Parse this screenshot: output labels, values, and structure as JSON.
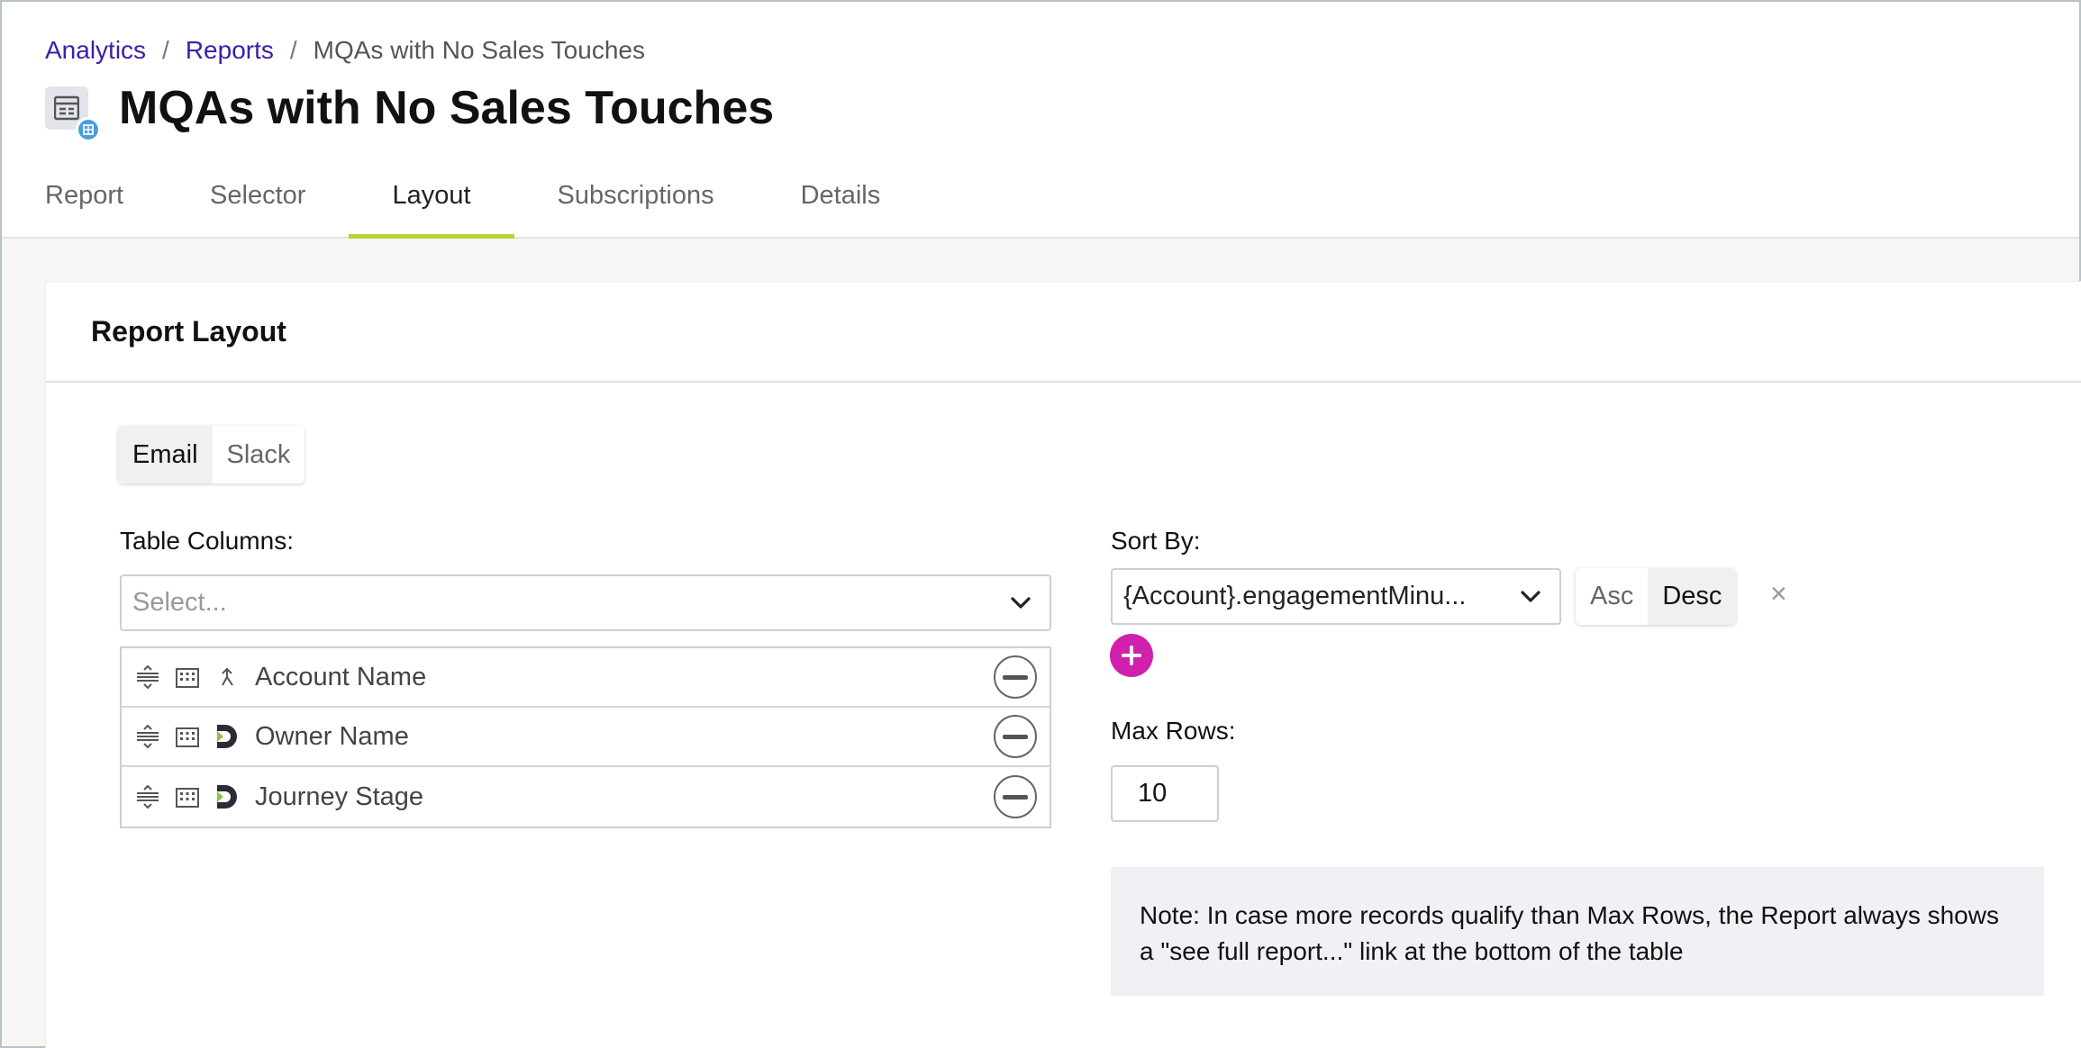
{
  "breadcrumb": {
    "items": [
      "Analytics",
      "Reports"
    ],
    "separator": "/",
    "current": "MQAs with No Sales Touches"
  },
  "page": {
    "title": "MQAs with No Sales Touches",
    "icon": "report-table-icon"
  },
  "tabs": [
    {
      "label": "Report",
      "active": false
    },
    {
      "label": "Selector",
      "active": false
    },
    {
      "label": "Layout",
      "active": true
    },
    {
      "label": "Subscriptions",
      "active": false
    },
    {
      "label": "Details",
      "active": false
    }
  ],
  "card": {
    "title": "Report Layout"
  },
  "channel_toggle": {
    "options": [
      "Email",
      "Slack"
    ],
    "selected": "Email"
  },
  "table_columns": {
    "label": "Table Columns:",
    "placeholder": "Select...",
    "rows": [
      {
        "name": "Account Name",
        "source_icon": "merge-icon"
      },
      {
        "name": "Owner Name",
        "source_icon": "d-logo-icon"
      },
      {
        "name": "Journey Stage",
        "source_icon": "d-logo-icon"
      }
    ]
  },
  "sort": {
    "label": "Sort By:",
    "value": "{Account}.engagementMinu...",
    "directions": [
      "Asc",
      "Desc"
    ],
    "selected_direction": "Desc",
    "clear": "×"
  },
  "max_rows": {
    "label": "Max Rows:",
    "value": "10"
  },
  "note": {
    "text": "Note: In case more records qualify than Max Rows, the Report always shows a \"see full report...\" link at the bottom of the table"
  },
  "colors": {
    "link": "#3a1fa8",
    "active_tab_underline": "#b4d334",
    "add_button": "#d11fae",
    "note_background": "#f1f0f5"
  }
}
